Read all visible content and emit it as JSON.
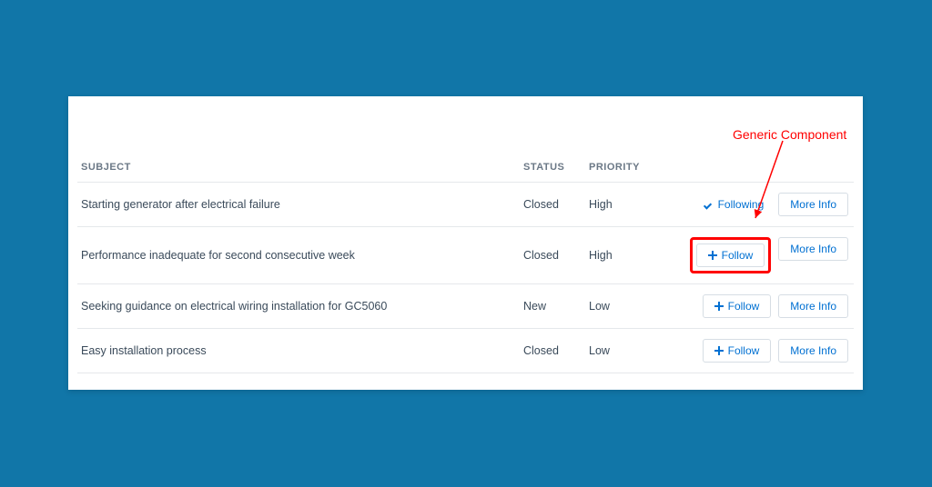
{
  "annotation": {
    "label": "Generic Component"
  },
  "headers": {
    "subject": "SUBJECT",
    "status": "STATUS",
    "priority": "PRIORITY"
  },
  "buttons": {
    "follow": "Follow",
    "following": "Following",
    "moreInfo": "More Info"
  },
  "rows": [
    {
      "subject": "Starting generator after electrical failure",
      "status": "Closed",
      "priority": "High",
      "following": true,
      "highlight": false
    },
    {
      "subject": "Performance inadequate for second consecutive week",
      "status": "Closed",
      "priority": "High",
      "following": false,
      "highlight": true
    },
    {
      "subject": "Seeking guidance on electrical wiring installation for GC5060",
      "status": "New",
      "priority": "Low",
      "following": false,
      "highlight": false
    },
    {
      "subject": "Easy installation process",
      "status": "Closed",
      "priority": "Low",
      "following": false,
      "highlight": false
    }
  ]
}
